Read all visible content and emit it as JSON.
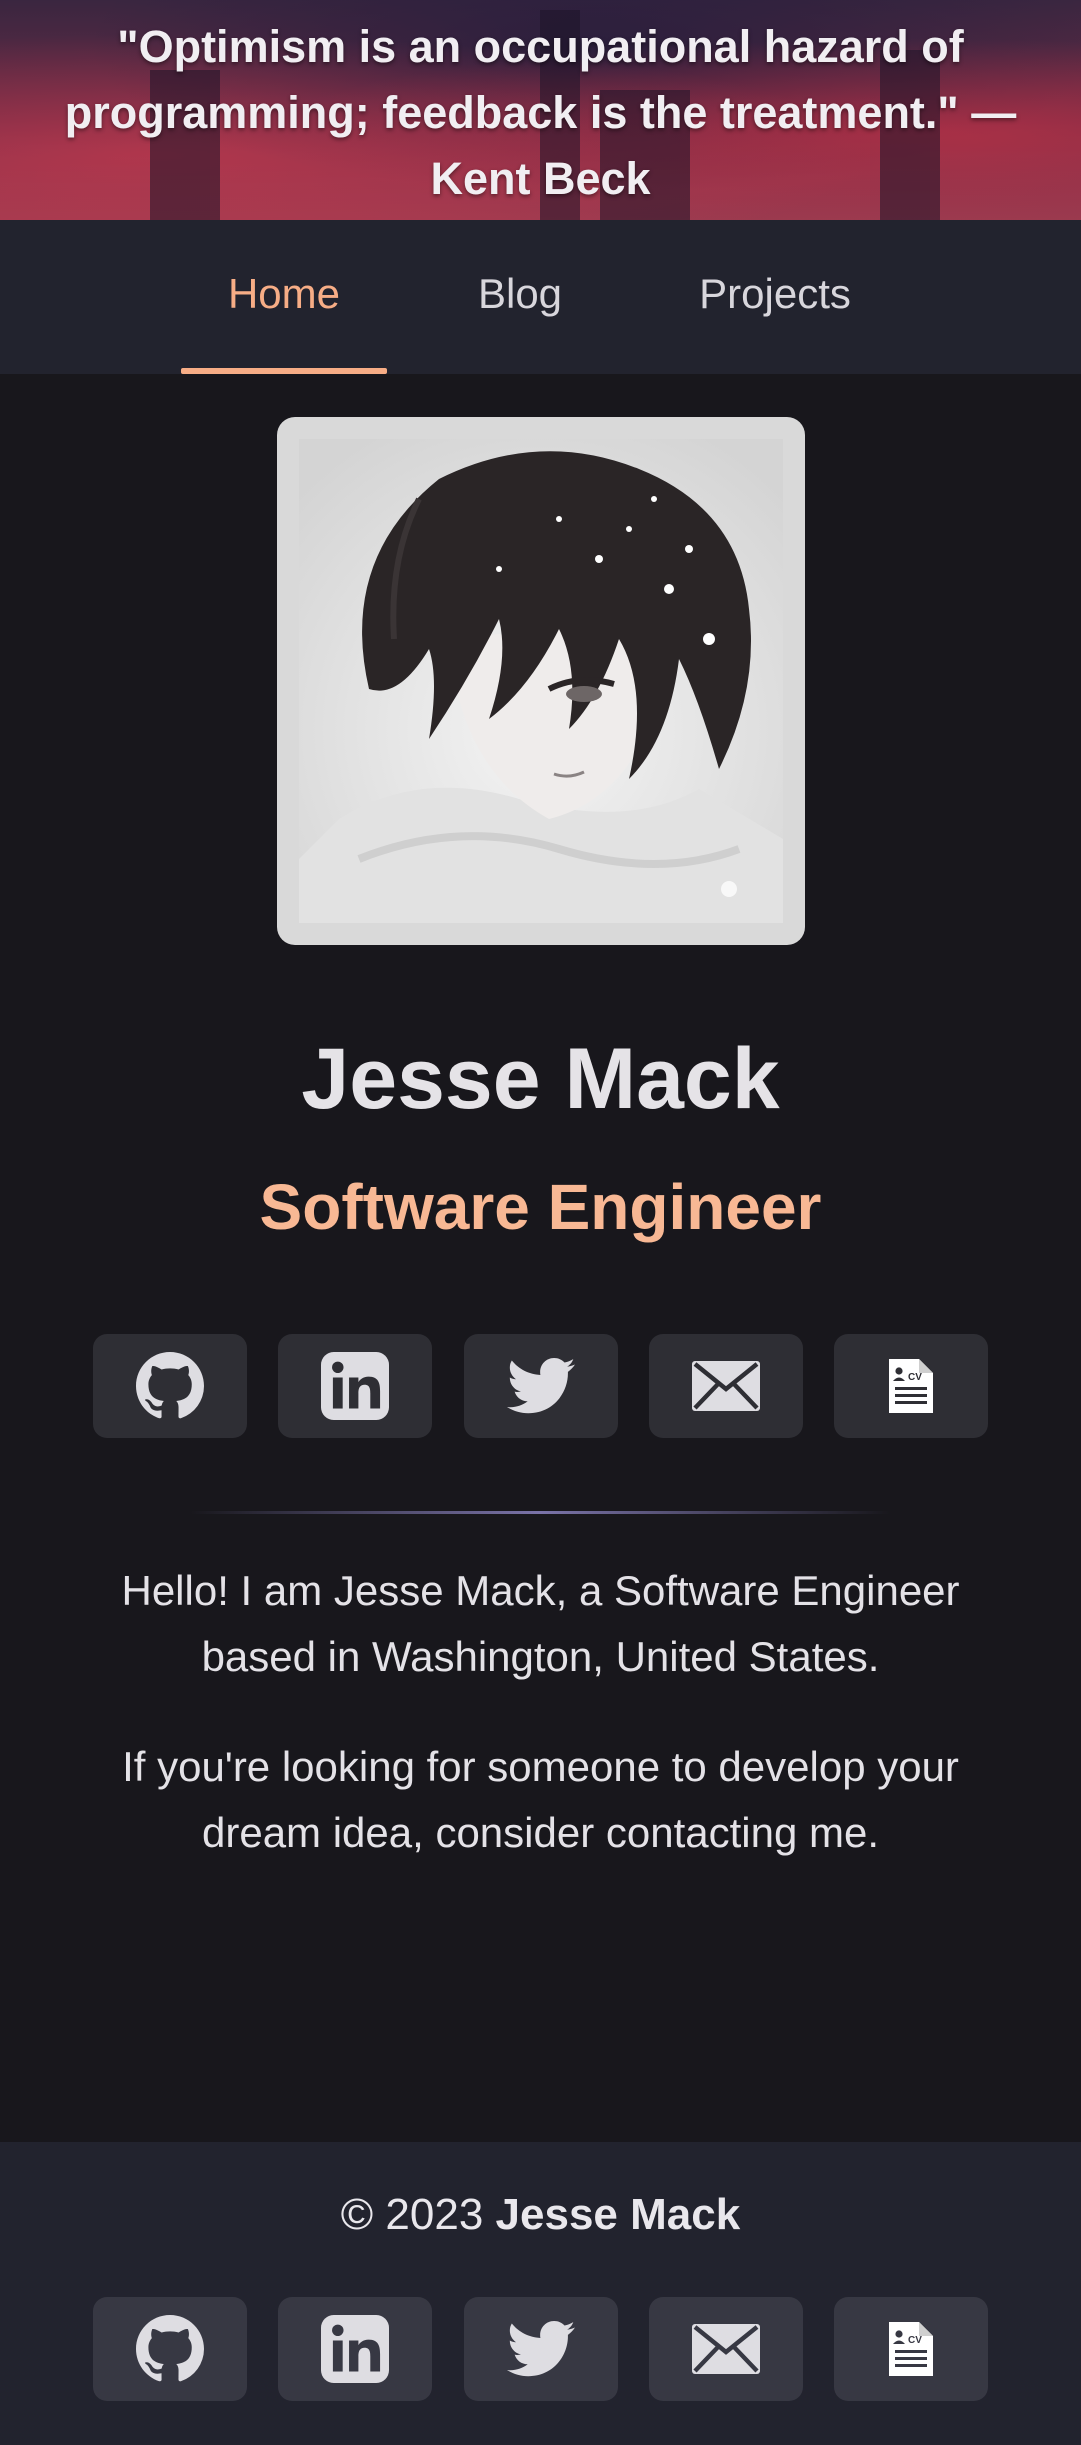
{
  "hero": {
    "quote_line1": "\"Optimism is an occupational hazard of",
    "quote_line2": "programming; feedback is the treatment.\" —",
    "quote_line3": "Kent Beck"
  },
  "nav": {
    "items": [
      {
        "label": "Home",
        "active": true
      },
      {
        "label": "Blog",
        "active": false
      },
      {
        "label": "Projects",
        "active": false
      }
    ]
  },
  "profile": {
    "name": "Jesse Mack",
    "title": "Software Engineer"
  },
  "social_icons": [
    "github-icon",
    "linkedin-icon",
    "twitter-icon",
    "mail-icon",
    "resume-cv-icon"
  ],
  "about": {
    "paragraph1": "Hello! I am Jesse Mack, a Software Engineer based in Washington, United States.",
    "paragraph2": "If you're looking for someone to develop your dream idea, consider contacting me."
  },
  "footer": {
    "copyright_prefix": "© 2023",
    "copyright_name": "Jesse Mack"
  },
  "colors": {
    "accent": "#f7ad86",
    "background": "#18171c",
    "nav_background": "#22232e",
    "icon_button": "#2e2e34"
  }
}
